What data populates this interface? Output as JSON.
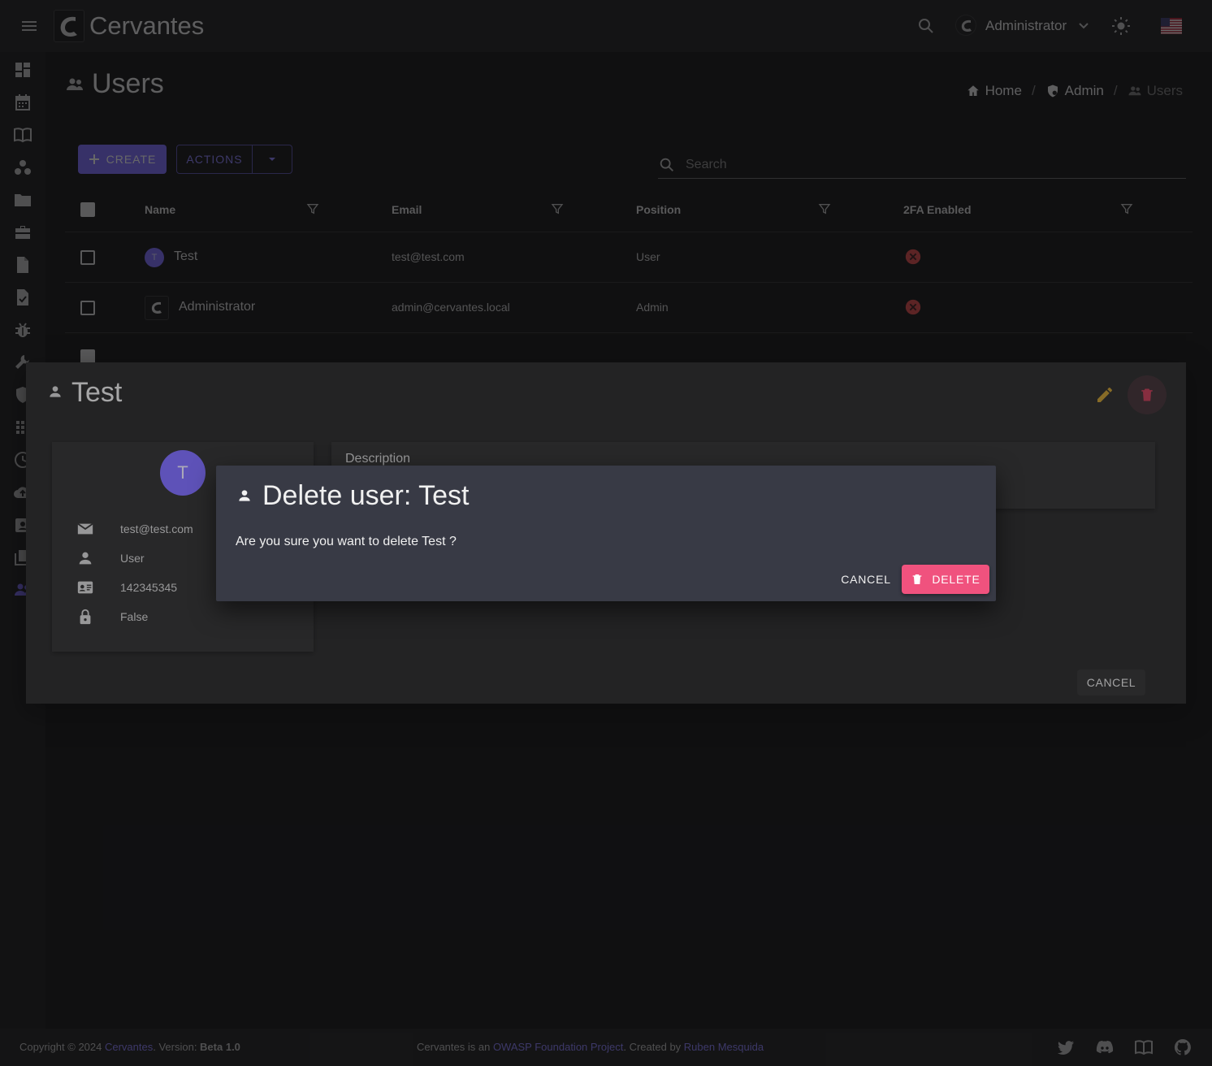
{
  "app": {
    "name": "Cervantes",
    "user_name": "Administrator"
  },
  "page": {
    "title": "Users",
    "breadcrumb": [
      "Home",
      "Admin",
      "Users"
    ]
  },
  "toolbar": {
    "create_label": "CREATE",
    "actions_label": "ACTIONS",
    "search_placeholder": "Search"
  },
  "table": {
    "columns": [
      "Name",
      "Email",
      "Position",
      "2FA Enabled"
    ],
    "rows": [
      {
        "avatar": "T",
        "name": "Test",
        "email": "test@test.com",
        "position": "User",
        "two_fa": false
      },
      {
        "avatar": "",
        "name": "Administrator",
        "email": "admin@cervantes.local",
        "position": "Admin",
        "two_fa": false
      }
    ]
  },
  "view_dialog": {
    "title": "Test",
    "avatar": "T",
    "email": "test@test.com",
    "position": "User",
    "phone": "142345345",
    "two_fa": "False",
    "description_label": "Description",
    "cancel_label": "CANCEL"
  },
  "confirm_dialog": {
    "title": "Delete user: Test",
    "message": "Are you sure you want to delete Test ?",
    "cancel_label": "CANCEL",
    "delete_label": "DELETE"
  },
  "footer": {
    "copyright": "Copyright © 2024 ",
    "brand_link": "Cervantes",
    "version_prefix": ". Version: ",
    "version": "Beta 1.0",
    "center_prefix": "Cervantes is an ",
    "owasp_link": "OWASP Foundation Project",
    "center_mid": ". Created by ",
    "author_link": "Ruben Mesquida"
  },
  "colors": {
    "primary": "#7c6bff",
    "danger": "#f0527e",
    "warning": "#e0b030",
    "dialog_bg": "#383a45"
  },
  "icons": {
    "sidebar": [
      "dashboard-icon",
      "calendar-icon",
      "book-icon",
      "workspaces-icon",
      "folder-icon",
      "briefcase-icon",
      "document-icon",
      "checklist-icon",
      "bug-icon",
      "build-icon",
      "shield-icon",
      "apps-icon",
      "history-icon",
      "cloud-upload-icon",
      "contact-icon",
      "library-icon",
      "users-icon"
    ]
  }
}
